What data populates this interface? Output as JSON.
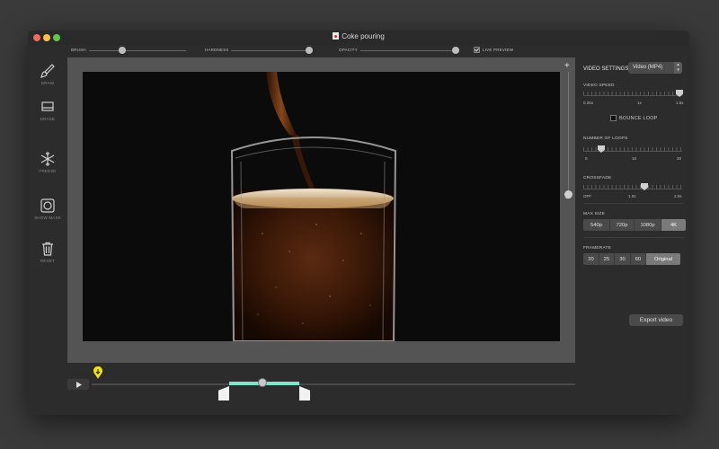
{
  "window": {
    "title": "Coke pouring"
  },
  "toolbar": {
    "brush_label": "BRUSH",
    "hardness_label": "HARDNESS",
    "opacity_label": "OPACITY",
    "live_preview_label": "LIVE PREVIEW",
    "live_preview_checked": true
  },
  "tools": {
    "draw": "DRAW",
    "erase": "ERASE",
    "freeze": "FREEZE",
    "show_mask": "SHOW MASK",
    "reset": "RESET"
  },
  "panel": {
    "video_settings_label": "VIDEO SETTINGS",
    "format_value": "Video (MP4)",
    "video_speed_label": "VIDEO SPEED",
    "speed_ticks": [
      "0.25x",
      "1x",
      "1.5x"
    ],
    "bounce_loop_label": "BOUNCE LOOP",
    "loops_label": "NUMBER OF LOOPS",
    "loops_ticks": [
      "0",
      "10",
      "20"
    ],
    "crossfade_label": "CROSSFADE",
    "crossfade_ticks": [
      "OFF",
      "1.0s",
      "2.0s"
    ],
    "max_size_label": "MAX SIZE",
    "max_size_options": [
      "540p",
      "720p",
      "1080p",
      "4K"
    ],
    "max_size_selected": "4K",
    "framerate_label": "FRAMERATE",
    "framerate_options": [
      "20",
      "25",
      "30",
      "60",
      "Original"
    ],
    "framerate_selected": "Original",
    "export_label": "Export video"
  },
  "colors": {
    "selection": "#7fe3c9",
    "playhead_pin": "#f2e11a",
    "close": "#ed6a5e",
    "minimize": "#f5bf4f",
    "zoom": "#61c554"
  },
  "icons": {
    "draw": "brush-icon",
    "erase": "eraser-icon",
    "freeze": "snowflake-icon",
    "show_mask": "mask-icon",
    "reset": "trash-icon",
    "play": "play-icon"
  }
}
